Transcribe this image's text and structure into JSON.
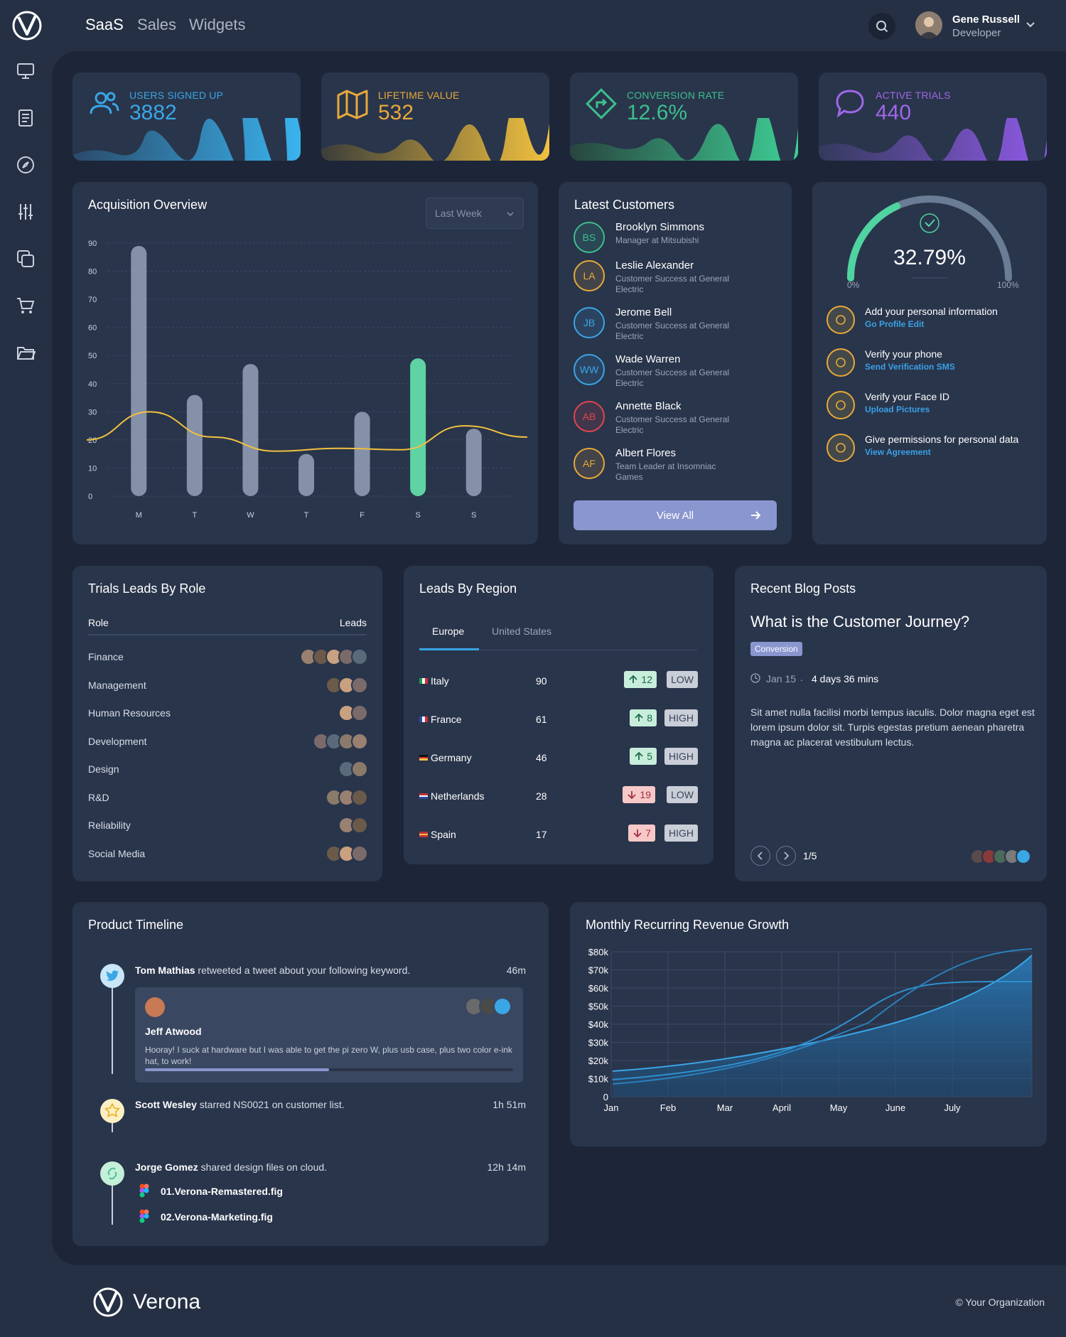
{
  "nav": {
    "items": [
      "SaaS",
      "Sales",
      "Widgets"
    ]
  },
  "user": {
    "name": "Gene Russell",
    "role": "Developer"
  },
  "sidebar": {
    "icons": [
      "monitor-icon",
      "document-icon",
      "compass-icon",
      "sliders-icon",
      "copy-icon",
      "cart-icon",
      "folder-icon"
    ]
  },
  "kpis": [
    {
      "label": "USERS SIGNED UP",
      "value": "3882",
      "color": "#3aa6e6",
      "icon": "users-icon"
    },
    {
      "label": "LIFETIME VALUE",
      "value": "532",
      "color": "#e8a93a",
      "icon": "map-icon"
    },
    {
      "label": "CONVERSION RATE",
      "value": "12.6%",
      "color": "#3cbf8e",
      "icon": "direction-icon"
    },
    {
      "label": "ACTIVE TRIALS",
      "value": "440",
      "color": "#a067e8",
      "icon": "chat-icon"
    }
  ],
  "acquisition": {
    "title": "Acquisition Overview",
    "select": "Last Week"
  },
  "chart_data": [
    {
      "type": "bar",
      "title": "Acquisition Overview",
      "categories": [
        "M",
        "T",
        "W",
        "T",
        "F",
        "S",
        "S"
      ],
      "values": [
        89,
        36,
        47,
        15,
        30,
        49,
        24
      ],
      "ylim": [
        0,
        90
      ],
      "yticks": [
        0,
        10,
        20,
        30,
        40,
        50,
        60,
        70,
        80,
        90
      ],
      "series_line": [
        20,
        30,
        21,
        16,
        17,
        16.5,
        25,
        21
      ],
      "highlight_index": 5
    },
    {
      "type": "area",
      "title": "Monthly Recurring Revenue Growth",
      "categories": [
        "Jan",
        "Feb",
        "Mar",
        "April",
        "May",
        "June",
        "July"
      ],
      "yticks": [
        "0",
        "$10k",
        "$20k",
        "$30k",
        "$40k",
        "$50k",
        "$60k",
        "$70k",
        "$80k"
      ],
      "ylim": [
        0,
        80
      ]
    }
  ],
  "customers": {
    "title": "Latest Customers",
    "button": "View All",
    "items": [
      {
        "initials": "BS",
        "name": "Brooklyn Simmons",
        "role": "Manager at Mitsubishi",
        "color": "#3cbf8e"
      },
      {
        "initials": "LA",
        "name": "Leslie Alexander",
        "role": "Customer Success at General Electric",
        "color": "#e8a93a"
      },
      {
        "initials": "JB",
        "name": "Jerome Bell",
        "role": "Customer Success at General Electric",
        "color": "#3aa6e6"
      },
      {
        "initials": "WW",
        "name": "Wade Warren",
        "role": "Customer Success at General Electric",
        "color": "#3aa6e6"
      },
      {
        "initials": "AB",
        "name": "Annette Black",
        "role": "Customer Success at General Electric",
        "color": "#e0464e"
      },
      {
        "initials": "AF",
        "name": "Albert Flores",
        "role": "Team Leader at Insomniac Games",
        "color": "#e8a93a"
      }
    ]
  },
  "profile": {
    "percent": "32.79%",
    "min": "0%",
    "max": "100%",
    "tasks": [
      {
        "title": "Add your personal information",
        "link": "Go Profile Edit",
        "icon": "user-edit-icon"
      },
      {
        "title": "Verify your phone",
        "link": "Send Verification SMS",
        "icon": "send-icon"
      },
      {
        "title": "Verify your Face ID",
        "link": "Upload Pictures",
        "icon": "camera-icon"
      },
      {
        "title": "Give permissions for personal data",
        "link": "View Agreement",
        "icon": "briefcase-icon"
      }
    ]
  },
  "roles": {
    "title": "Trials Leads By Role",
    "col1": "Role",
    "col2": "Leads",
    "rows": [
      {
        "role": "Finance",
        "count": 5
      },
      {
        "role": "Management",
        "count": 3
      },
      {
        "role": "Human Resources",
        "count": 2
      },
      {
        "role": "Development",
        "count": 4
      },
      {
        "role": "Design",
        "count": 2
      },
      {
        "role": "R&D",
        "count": 3
      },
      {
        "role": "Reliability",
        "count": 2
      },
      {
        "role": "Social Media",
        "count": 3
      }
    ]
  },
  "regions": {
    "title": "Leads By Region",
    "tabs": [
      "Europe",
      "United States"
    ],
    "rows": [
      {
        "country": "Italy",
        "value": "90",
        "delta": "12",
        "up": true,
        "level": "LOW"
      },
      {
        "country": "France",
        "value": "61",
        "delta": "8",
        "up": true,
        "level": "HIGH"
      },
      {
        "country": "Germany",
        "value": "46",
        "delta": "5",
        "up": true,
        "level": "HIGH"
      },
      {
        "country": "Netherlands",
        "value": "28",
        "delta": "19",
        "up": false,
        "level": "LOW"
      },
      {
        "country": "Spain",
        "value": "17",
        "delta": "7",
        "up": false,
        "level": "HIGH"
      }
    ]
  },
  "blog": {
    "title": "Recent Blog Posts",
    "post_title": "What is the Customer Journey?",
    "tag": "Conversion",
    "date": "Jan 15",
    "sep": ".",
    "duration": "4 days 36 mins",
    "body": "Sit amet nulla facilisi morbi tempus iaculis. Dolor magna eget est lorem ipsum dolor sit. Turpis egestas pretium aenean pharetra magna ac placerat vestibulum lectus.",
    "pager": "1/5"
  },
  "timeline": {
    "title": "Product Timeline",
    "items": [
      {
        "who": "Tom Mathias",
        "text": " retweeted a tweet about your following keyword.",
        "time": "46m",
        "icon": "twitter-icon"
      },
      {
        "who": "Scott Wesley",
        "text": " starred NS0021 on customer list.",
        "time": "1h 51m",
        "icon": "star-icon"
      },
      {
        "who": "Jorge Gomez",
        "text": " shared design files on cloud.",
        "time": "12h 14m",
        "icon": "link-icon"
      }
    ],
    "tweet": {
      "author": "Jeff Atwood",
      "text": "Hooray! I suck at hardware but I was able to get the pi zero W, plus usb case, plus two color e-ink hat, to work!",
      "progress": 0.5
    },
    "files": [
      "01.Verona-Remastered.fig",
      "02.Verona-Marketing.fig"
    ]
  },
  "mrr": {
    "title": "Monthly Recurring Revenue Growth"
  },
  "footer": {
    "brand": "Verona",
    "copyright": "© Your Organization"
  }
}
